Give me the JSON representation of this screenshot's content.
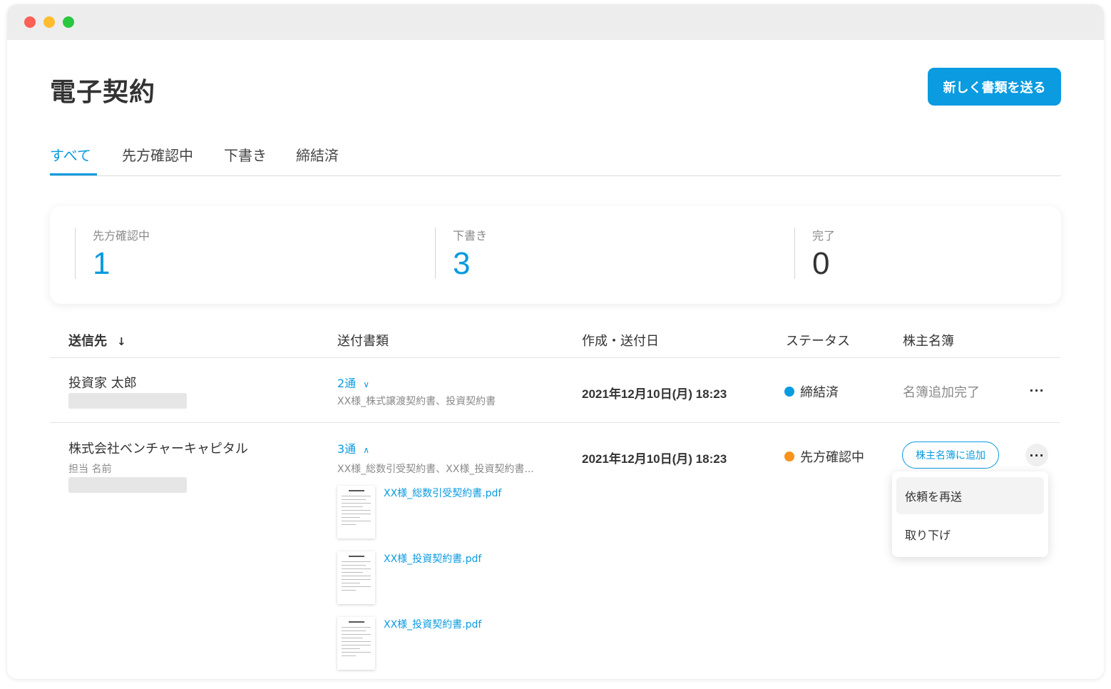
{
  "app": {
    "title": "電子契約",
    "new_button": "新しく書類を送る"
  },
  "tabs": [
    {
      "label": "すべて",
      "active": true
    },
    {
      "label": "先方確認中",
      "active": false
    },
    {
      "label": "下書き",
      "active": false
    },
    {
      "label": "締結済",
      "active": false
    }
  ],
  "summary": [
    {
      "label": "先方確認中",
      "value": "1"
    },
    {
      "label": "下書き",
      "value": "3"
    },
    {
      "label": "完了",
      "value": "0"
    }
  ],
  "table": {
    "headers": {
      "recipient": "送信先",
      "documents": "送付書類",
      "date": "作成・送付日",
      "status": "ステータス",
      "registry": "株主名簿"
    },
    "sort_icon": "arrow-down-icon",
    "rows": [
      {
        "name": "投資家 太郎",
        "contact": "",
        "doc_count": "2通",
        "expanded": false,
        "doc_summary": "XX様_株式譲渡契約書、投資契約書",
        "date": "2021年12月10日(月) 18:23",
        "status": "締結済",
        "status_color": "#0a9be0",
        "registry": "名簿追加完了",
        "files": []
      },
      {
        "name": "株式会社ベンチャーキャピタル",
        "contact": "担当 名前",
        "doc_count": "3通",
        "expanded": true,
        "doc_summary": "XX様_総数引受契約書、XX様_投資契約書...",
        "date": "2021年12月10日(月) 18:23",
        "status": "先方確認中",
        "status_color": "#f7931e",
        "registry_button": "株主名簿に追加",
        "files": [
          {
            "name": "XX様_総数引受契約書.pdf"
          },
          {
            "name": "XX様_投資契約書.pdf"
          },
          {
            "name": "XX様_投資契約書.pdf"
          }
        ]
      }
    ]
  },
  "context_menu": {
    "items": [
      "依頼を再送",
      "取り下げ"
    ]
  },
  "colors": {
    "accent": "#0a9be0",
    "pending": "#f7931e"
  }
}
